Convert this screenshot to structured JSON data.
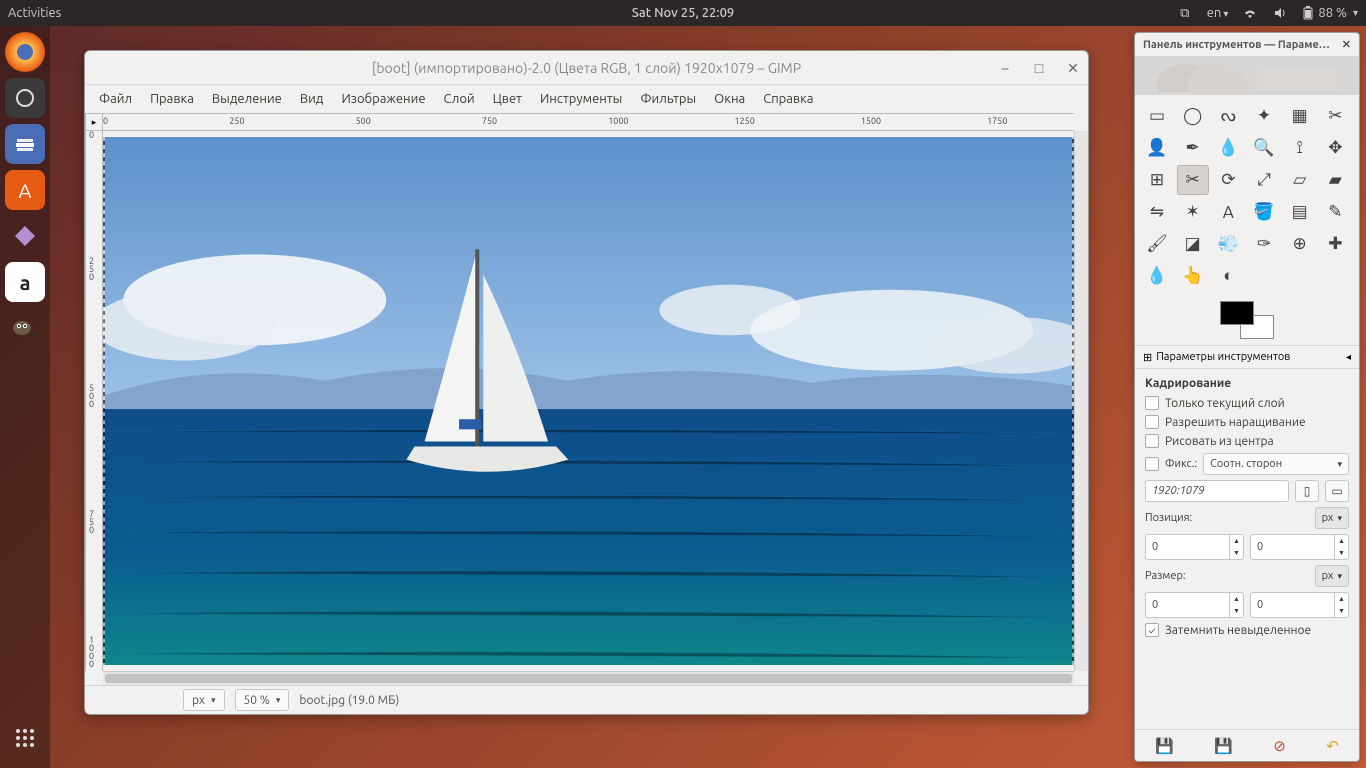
{
  "topbar": {
    "activities": "Activities",
    "datetime": "Sat Nov 25, 22:09",
    "lang": "en",
    "battery": "88 %"
  },
  "gimp": {
    "title": "[boot] (импортировано)-2.0 (Цвета RGB, 1 слой) 1920x1079 – GIMP",
    "menu": [
      "Файл",
      "Правка",
      "Выделение",
      "Вид",
      "Изображение",
      "Слой",
      "Цвет",
      "Инструменты",
      "Фильтры",
      "Окна",
      "Справка"
    ],
    "ruler_h": [
      "0",
      "250",
      "500",
      "750",
      "1000",
      "1250",
      "1500",
      "1750"
    ],
    "ruler_v": [
      "0",
      "250",
      "500",
      "750",
      "1000"
    ],
    "status": {
      "unit": "px",
      "zoom": "50 %",
      "file": "boot.jpg (19.0 МБ)"
    }
  },
  "panel": {
    "title": "Панель инструментов — Параме…",
    "tools": [
      "rect-select-icon",
      "ellipse-select-icon",
      "free-select-icon",
      "fuzzy-select-icon",
      "select-by-color-icon",
      "scissors-icon",
      "foreground-select-icon",
      "paths-icon",
      "color-picker-icon",
      "zoom-icon",
      "measure-icon",
      "move-icon",
      "align-icon",
      "crop-icon",
      "rotate-icon",
      "scale-icon",
      "shear-icon",
      "perspective-icon",
      "flip-icon",
      "cage-icon",
      "text-icon",
      "bucket-icon",
      "blend-icon",
      "pencil-icon",
      "paintbrush-icon",
      "eraser-icon",
      "airbrush-icon",
      "ink-icon",
      "clone-icon",
      "heal-icon",
      "blur-icon",
      "smudge-icon",
      "dodge-icon",
      "",
      "",
      ""
    ],
    "selected_tool_index": 13,
    "tab": "Параметры инструментов",
    "options": {
      "heading": "Кадрирование",
      "chk_current_layer": "Только текущий слой",
      "chk_allow_growing": "Разрешить наращивание",
      "chk_from_center": "Рисовать из центра",
      "chk_fixed": "Фикс.:",
      "fixed_value": "Соотн. сторон",
      "aspect": "1920:1079",
      "position_lbl": "Позиция:",
      "unit_px": "px",
      "pos_x": "0",
      "pos_y": "0",
      "size_lbl": "Размер:",
      "size_w": "0",
      "size_h": "0",
      "darken": "Затемнить невыделенное"
    }
  }
}
